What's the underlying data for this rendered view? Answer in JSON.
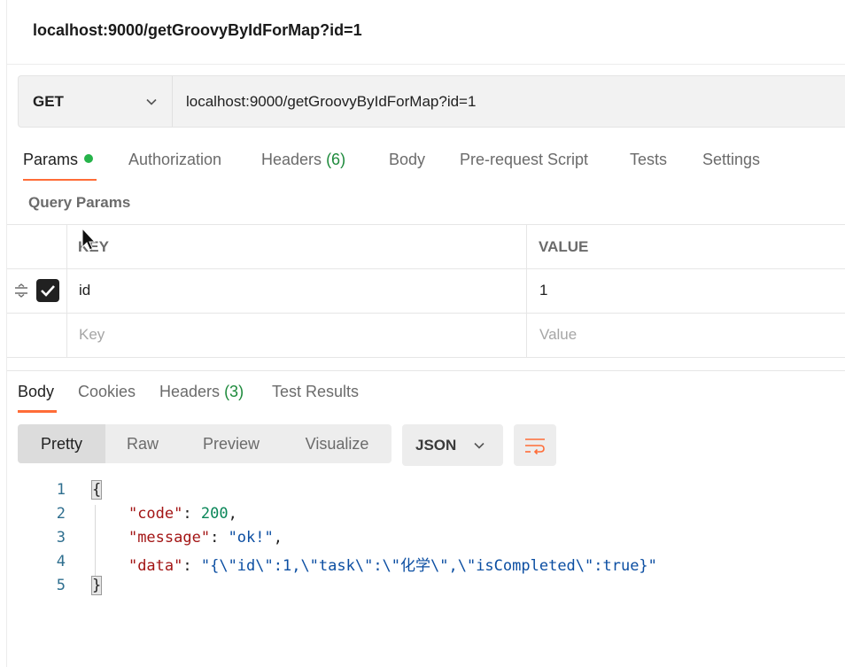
{
  "request": {
    "title": "localhost:9000/getGroovyByIdForMap?id=1",
    "method": "GET",
    "url": "localhost:9000/getGroovyByIdForMap?id=1"
  },
  "request_tabs": {
    "params": "Params",
    "authorization": "Authorization",
    "headers": "Headers",
    "headers_count": "(6)",
    "body": "Body",
    "pre_request": "Pre-request Script",
    "tests": "Tests",
    "settings": "Settings"
  },
  "query_params": {
    "title": "Query Params",
    "columns": {
      "key": "KEY",
      "value": "VALUE"
    },
    "rows": [
      {
        "key": "id",
        "value": "1",
        "checked": true
      }
    ],
    "placeholder": {
      "key": "Key",
      "value": "Value"
    }
  },
  "response_tabs": {
    "body": "Body",
    "cookies": "Cookies",
    "headers": "Headers",
    "headers_count": "(3)",
    "test_results": "Test Results"
  },
  "view_modes": {
    "pretty": "Pretty",
    "raw": "Raw",
    "preview": "Preview",
    "visualize": "Visualize"
  },
  "format": "JSON",
  "response_body": {
    "line_numbers": [
      "1",
      "2",
      "3",
      "4",
      "5"
    ],
    "open_brace": "{",
    "close_brace": "}",
    "code_key": "\"code\"",
    "code_value": "200",
    "message_key": "\"message\"",
    "message_value": "\"ok!\"",
    "data_key": "\"data\"",
    "data_value": "\"{\\\"id\\\":1,\\\"task\\\":\\\"化学\\\",\\\"isCompleted\\\":true}\""
  },
  "icons": {
    "method_chevron": "chevron-down-icon",
    "format_chevron": "chevron-down-icon",
    "wrap": "wrap-lines-icon",
    "drag": "drag-handle-icon",
    "checkbox": "checkbox-checked-icon",
    "cursor": "mouse-pointer-icon"
  },
  "colors": {
    "accent": "#ff6c37",
    "status_dot": "#26b34a",
    "count": "#1e8a3c"
  }
}
